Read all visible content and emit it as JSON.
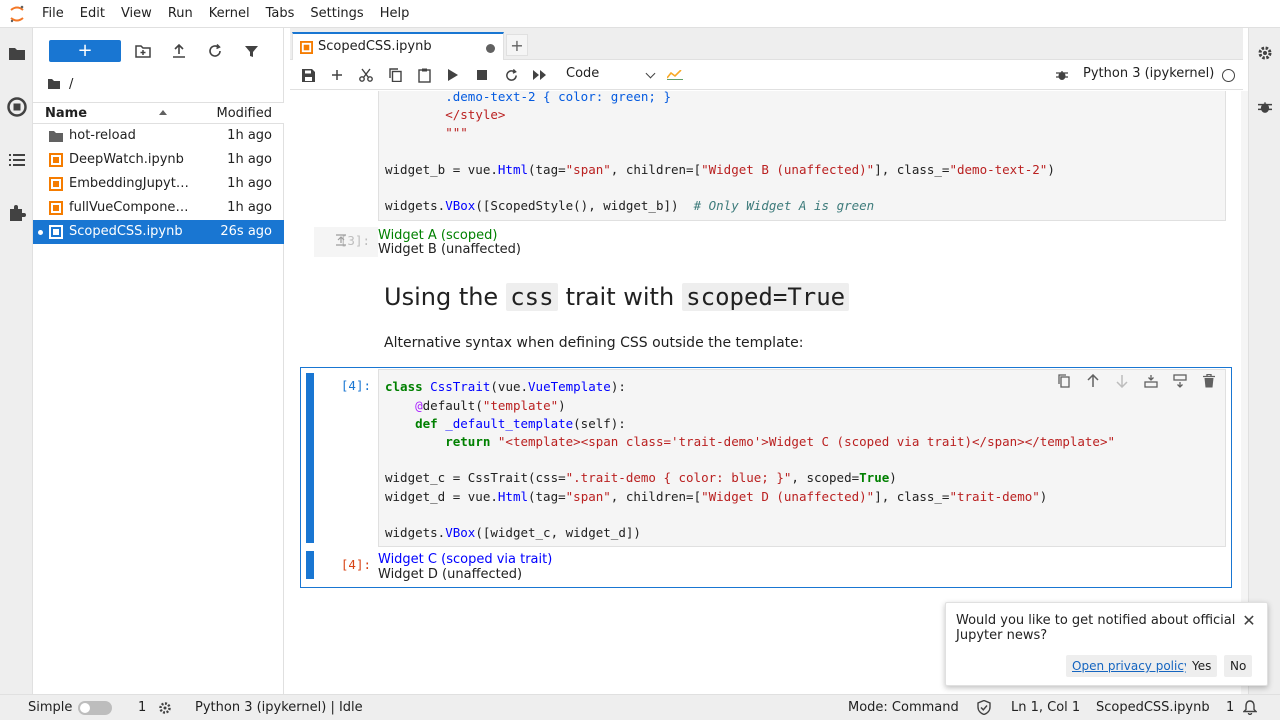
{
  "menubar": {
    "items": [
      "File",
      "Edit",
      "View",
      "Run",
      "Kernel",
      "Tabs",
      "Settings",
      "Help"
    ]
  },
  "filebrowser": {
    "new_label": "+",
    "breadcrumb": "/",
    "header": {
      "name": "Name",
      "modified": "Modified"
    },
    "files": [
      {
        "name": "hot-reload",
        "modified": "1h ago",
        "type": "folder"
      },
      {
        "name": "DeepWatch.ipynb",
        "modified": "1h ago",
        "type": "notebook"
      },
      {
        "name": "EmbeddingJupyter.ipynb",
        "modified": "1h ago",
        "type": "notebook"
      },
      {
        "name": "fullVueComponent.ipynb",
        "modified": "1h ago",
        "type": "notebook"
      },
      {
        "name": "ScopedCSS.ipynb",
        "modified": "26s ago",
        "type": "notebook",
        "selected": true
      }
    ]
  },
  "tab": {
    "label": "ScopedCSS.ipynb",
    "add": "+"
  },
  "toolbar": {
    "cell_type": "Code",
    "kernel": "Python 3 (ipykernel)"
  },
  "cells": {
    "cell3_prompt": "[3]:",
    "cell3_output_a": "Widget A (scoped)",
    "cell3_output_b": "Widget B (unaffected)",
    "heading_prefix": "Using the",
    "heading_code1": "css",
    "heading_mid": "trait with",
    "heading_code2": "scoped=True",
    "paragraph": "Alternative syntax when defining CSS outside the template:",
    "cell4_prompt": "[4]:",
    "cell4_out_prompt": "[4]:",
    "cell4_output_c": "Widget C (scoped via trait)",
    "cell4_output_d": "Widget D (unaffected)"
  },
  "toast": {
    "message": "Would you like to get notified about official Jupyter news?",
    "privacy": "Open privacy policy",
    "yes": "Yes",
    "no": "No",
    "close": "✕"
  },
  "statusbar": {
    "simple": "Simple",
    "terminals": "1",
    "kernel_status": "Python 3 (ipykernel) | Idle",
    "mode": "Mode: Command",
    "position": "Ln 1, Col 1",
    "filename": "ScopedCSS.ipynb",
    "notifications": "1"
  },
  "colors": {
    "accent": "#1976d2",
    "widget_a": "#008000",
    "widget_c": "#0000ff",
    "file_icon": "#f57c00"
  }
}
